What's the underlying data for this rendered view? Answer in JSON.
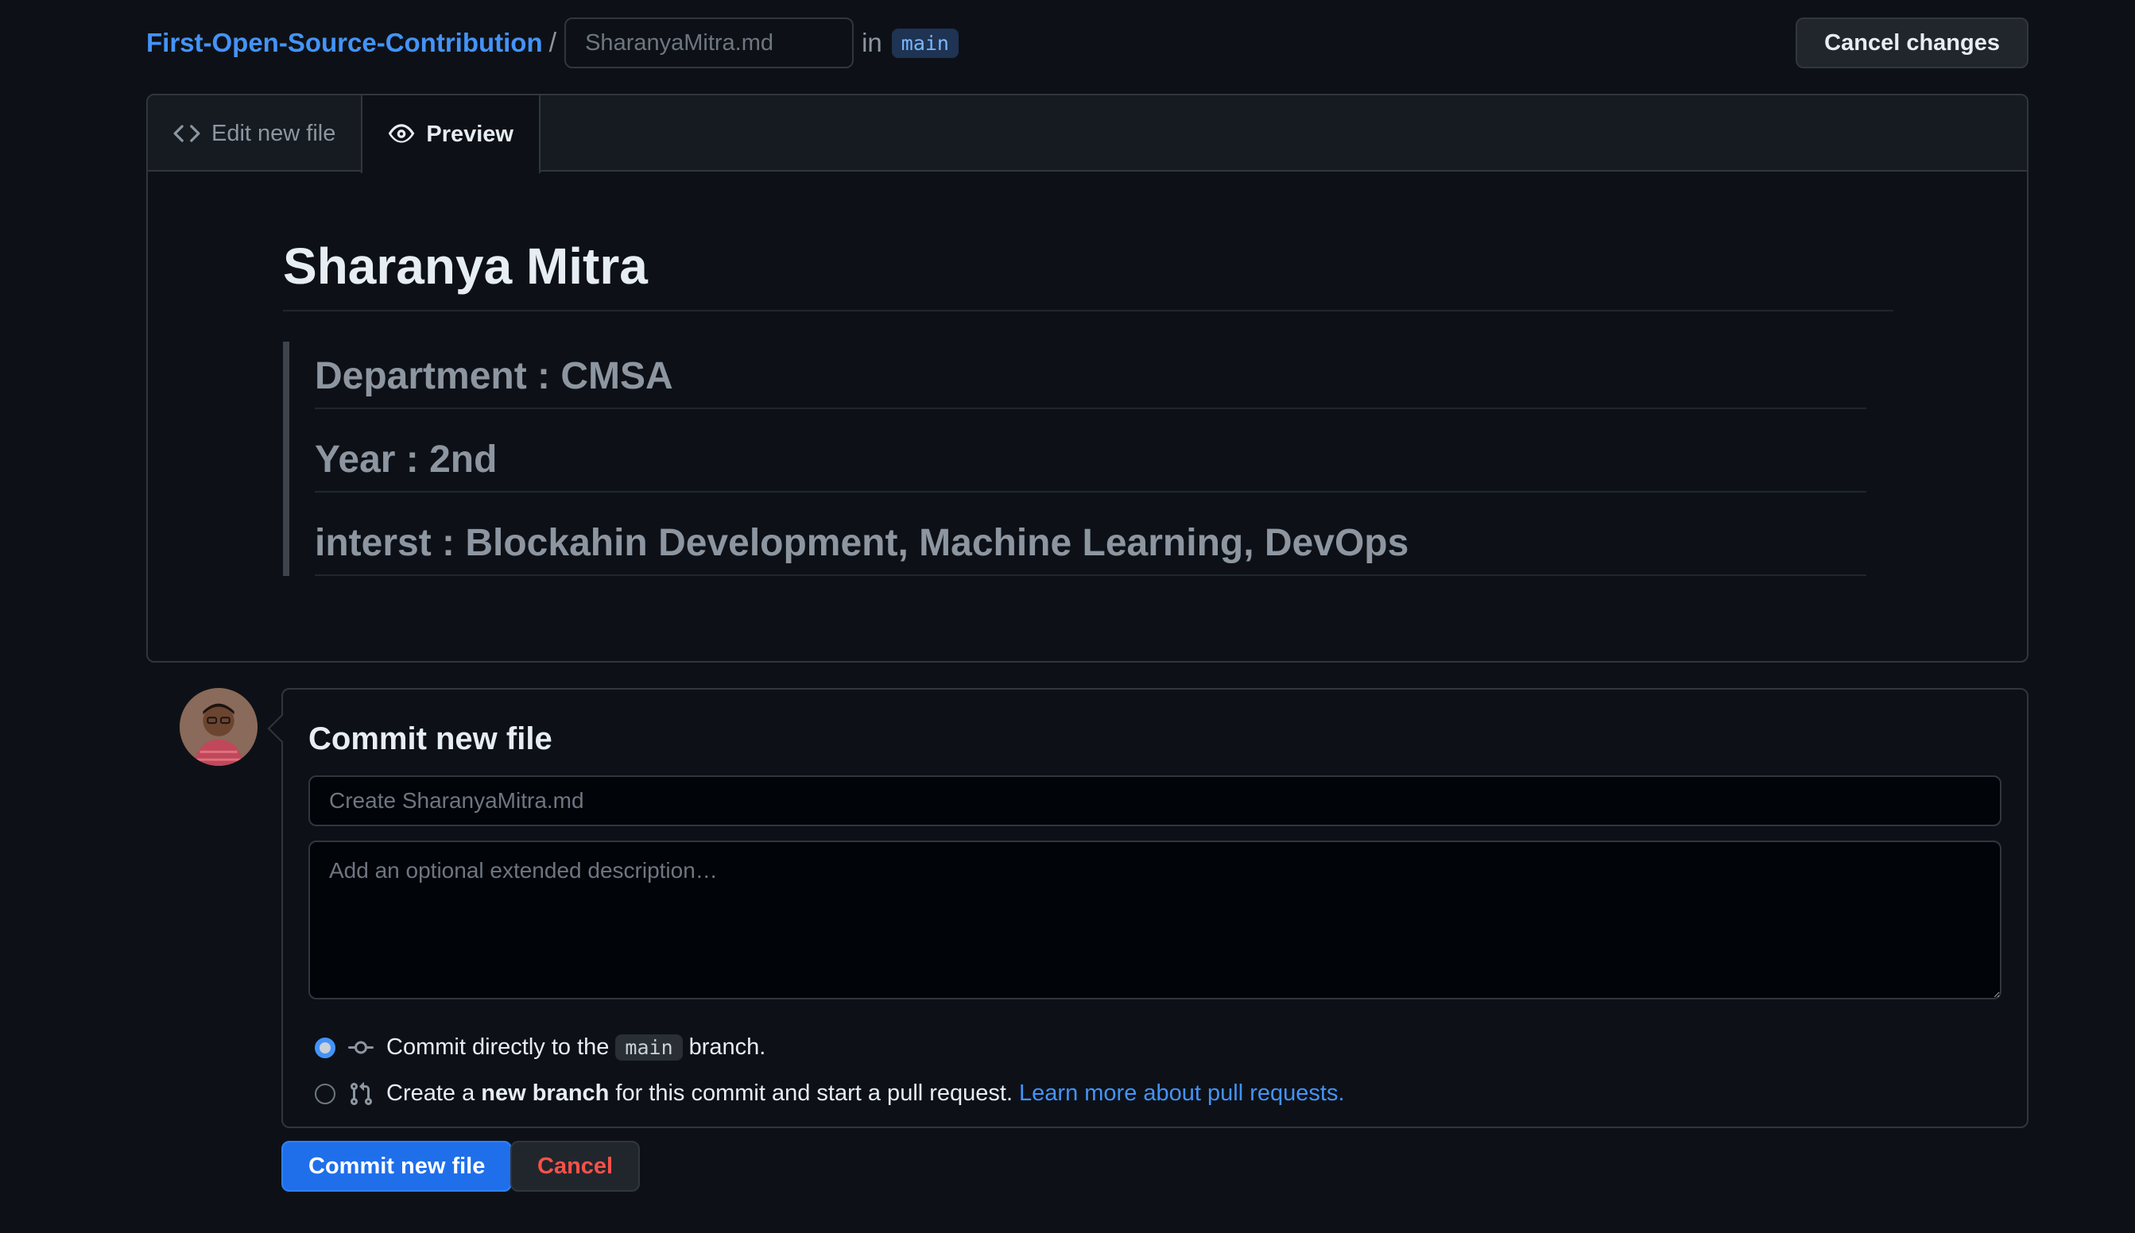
{
  "header": {
    "repo_name": "First-Open-Source-Contribution",
    "separator": "/",
    "filename_placeholder": "SharanyaMitra.md",
    "in_label": "in",
    "branch": "main",
    "cancel_changes_label": "Cancel changes"
  },
  "editor": {
    "tabs": [
      {
        "label": "Edit new file",
        "icon": "code-icon",
        "active": false
      },
      {
        "label": "Preview",
        "icon": "eye-icon",
        "active": true
      }
    ],
    "preview": {
      "title": "Sharanya Mitra",
      "blockquote_lines": [
        "Department : CMSA",
        "Year : 2nd",
        "interst : Blockahin Development, Machine Learning, DevOps"
      ]
    }
  },
  "commit": {
    "title": "Commit new file",
    "summary_placeholder": "Create SharanyaMitra.md",
    "description_placeholder": "Add an optional extended description…",
    "option_direct": {
      "prefix": "Commit directly to the",
      "branch": "main",
      "suffix": "branch.",
      "selected": true
    },
    "option_new_branch": {
      "prefix": "Create a",
      "bold": "new branch",
      "suffix": "for this commit and start a pull request.",
      "link": "Learn more about pull requests.",
      "selected": false
    },
    "commit_button_label": "Commit new file",
    "cancel_button_label": "Cancel"
  },
  "colors": {
    "background": "#0d1117",
    "link": "#4493f8",
    "primary_button": "#1f6feb",
    "danger_text": "#f85149"
  }
}
